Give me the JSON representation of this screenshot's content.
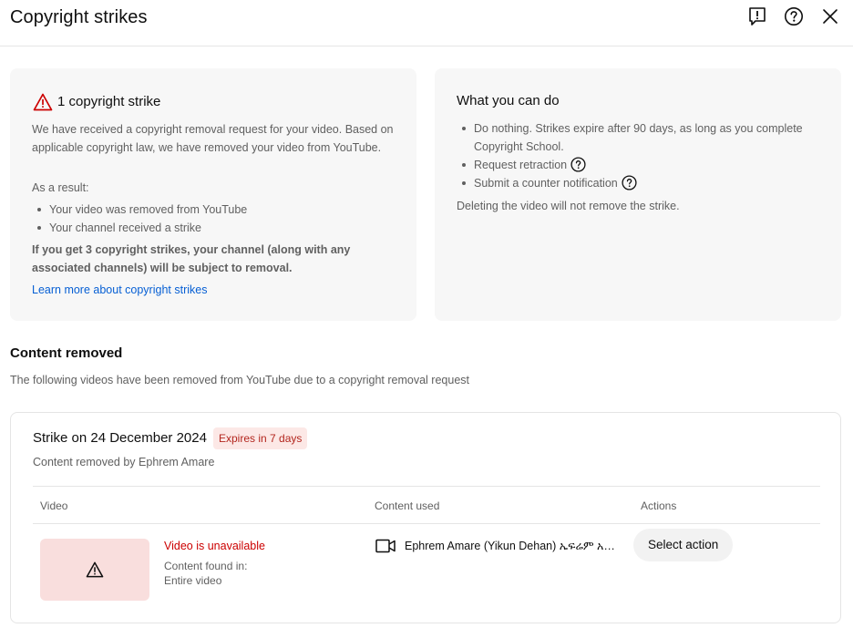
{
  "header": {
    "title": "Copyright strikes",
    "icons": [
      "feedback-icon",
      "help-icon",
      "close-icon"
    ]
  },
  "strike_card": {
    "count_label": "1 copyright strike",
    "intro": "We have received a copyright removal request for your video. Based on applicable copyright law, we have removed your video from YouTube.",
    "result_label": "As a result:",
    "results": [
      "Your video was removed from YouTube",
      "Your channel received a strike"
    ],
    "warning": "If you get 3 copyright strikes, your channel (along with any associated channels) will be subject to removal.",
    "learn_more": "Learn more about copyright strikes"
  },
  "actions_card": {
    "title": "What you can do",
    "options": [
      "Do nothing. Strikes expire after 90 days, as long as you complete Copyright School.",
      "Request retraction",
      "Submit a counter notification"
    ],
    "note": "Deleting the video will not remove the strike."
  },
  "content_removed": {
    "title": "Content removed",
    "subtitle": "The following videos have been removed from YouTube due to a copyright removal request"
  },
  "strike": {
    "date_label": "Strike on 24 December 2024",
    "expires": "Expires in 7 days",
    "removed_by": "Content removed by Ephrem Amare",
    "columns": [
      "Video",
      "Content used",
      "Actions"
    ],
    "row": {
      "status": "Video is unavailable",
      "found_in_label": "Content found in:",
      "found_in_value": "Entire video",
      "content_used": "Ephrem Amare (Yikun Dehan) ኤፍሬም አማሬ (ይኩን ደሃን)",
      "action_label": "Select action"
    }
  },
  "colors": {
    "link": "#065fd4",
    "error_red": "#cc0000",
    "badge_bg": "#fce8e6",
    "card_bg": "#f7f7f7"
  }
}
